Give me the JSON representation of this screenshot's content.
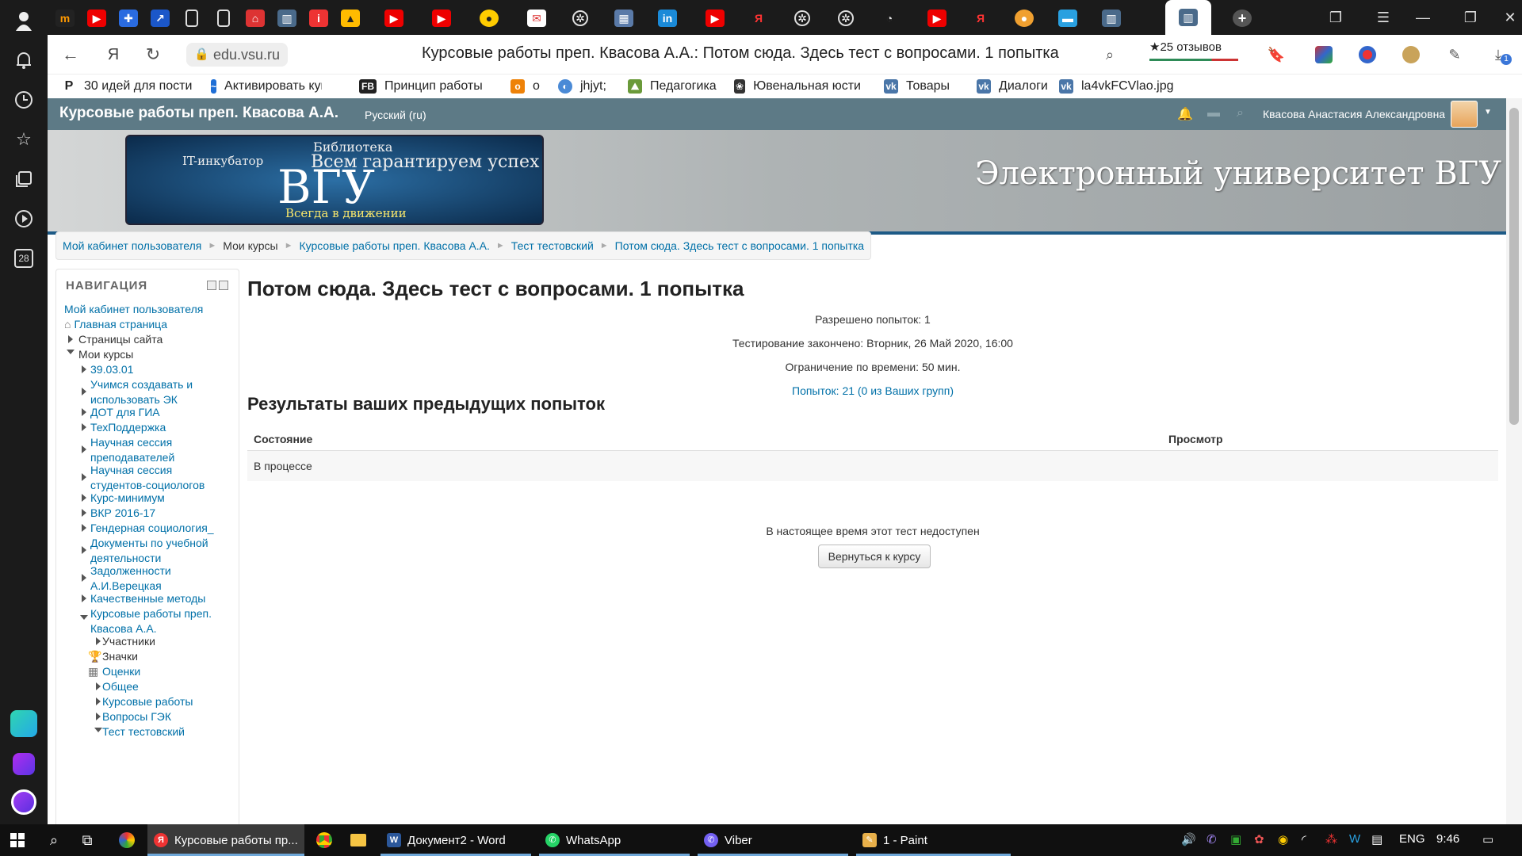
{
  "browser": {
    "url": "edu.vsu.ru",
    "page_title": "Курсовые работы преп. Квасова А.А.: Потом сюда. Здесь тест с вопросами. 1 попытка",
    "reviews": "★25 отзывов",
    "sidebar_badge": "28",
    "download_badge": "1"
  },
  "bookmarks": [
    {
      "label": "30 идей для пости",
      "icon": "P",
      "color": "#222"
    },
    {
      "label": "Активировать куп",
      "icon": "~",
      "color": "#1f6fd6"
    },
    {
      "label": "Принцип работы",
      "icon": "FB",
      "color": "#222"
    },
    {
      "label": "о",
      "icon": "ok",
      "color": "#ee8208"
    },
    {
      "label": "jhjyt;",
      "icon": "◐",
      "color": "#4a8ad6"
    },
    {
      "label": "Педагогика",
      "icon": "⛰",
      "color": "#6a9a3a"
    },
    {
      "label": "Ювенальная юсти",
      "icon": "❀",
      "color": "#333"
    },
    {
      "label": "Товары",
      "icon": "vk",
      "color": "#4a76a8"
    },
    {
      "label": "Диалоги",
      "icon": "vk",
      "color": "#4a76a8"
    },
    {
      "label": "la4vkFCVlao.jpg",
      "icon": "vk",
      "color": "#4a76a8"
    }
  ],
  "site": {
    "name": "Курсовые работы преп. Квасова А.А.",
    "language": "Русский (ru)",
    "user": "Квасова Анастасия Александровна",
    "banner_title": "Электронный университет ВГУ",
    "logo_text": "ВГУ",
    "logo_words": [
      "Библиотека",
      "IT-инкубатор",
      "Всем гарантируем успех",
      "Всегда в движении"
    ]
  },
  "breadcrumb": [
    "Мой кабинет пользователя",
    "Мои курсы",
    "Курсовые работы преп. Квасова А.А.",
    "Тест тестовский",
    "Потом сюда. Здесь тест с вопросами. 1 попытка"
  ],
  "nav": {
    "heading": "НАВИГАЦИЯ",
    "items": [
      "Мой кабинет пользователя",
      "Главная страница",
      "Страницы сайта",
      "Мои курсы",
      "39.03.01",
      "Учимся создавать и",
      "использовать ЭК",
      "ДОТ для ГИА",
      "ТехПоддержка",
      "Научная сессия",
      "преподавателей",
      "Научная сессия",
      "студентов-социологов",
      "Курс-минимум",
      "ВКР 2016-17",
      "Гендерная социология_",
      "Документы по учебной",
      "деятельности",
      "Задолженности",
      "А.И.Верецкая",
      "Качественные методы",
      "Курсовые работы преп.",
      "Квасова А.А.",
      "Участники",
      "Значки",
      "Оценки",
      "Общее",
      "Курсовые работы",
      "Вопросы ГЭК",
      "Тест тестовский"
    ]
  },
  "quiz": {
    "title": "Потом сюда. Здесь тест с вопросами. 1 попытка",
    "attempts_allowed": "Разрешено попыток: 1",
    "closed": "Тестирование закончено: Вторник, 26 Май 2020, 16:00",
    "time_limit": "Ограничение по времени: 50 мин.",
    "attempts_link": "Попыток: 21 (0 из Ваших групп)",
    "results_heading": "Результаты ваших предыдущих попыток",
    "col_state": "Состояние",
    "col_review": "Просмотр",
    "row_state": "В процессе",
    "unavailable": "В настоящее время этот тест недоступен",
    "back_button": "Вернуться к курсу"
  },
  "taskbar": {
    "apps": [
      "Курсовые работы пр...",
      "Документ2 - Word",
      "WhatsApp",
      "Viber",
      "1 - Paint"
    ],
    "lang": "ENG",
    "time": "9:46"
  }
}
